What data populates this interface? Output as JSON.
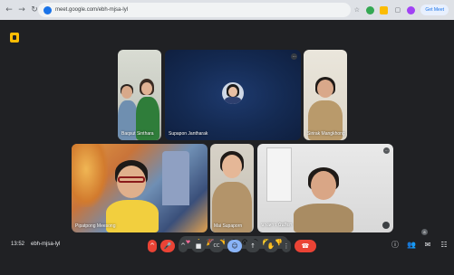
{
  "browser": {
    "url": "meet.google.com/ebh-mjsa-lyl",
    "profile_label": "Get Meet"
  },
  "meeting": {
    "time": "13:52",
    "code": "ebh-mjsa-lyl",
    "participant_count": "8"
  },
  "tiles": [
    {
      "name": "Baqsut Sinthara",
      "badge": ""
    },
    {
      "name": "Supapon Jantharak",
      "badge": "⋯"
    },
    {
      "name": "Sirirak Mangkhong",
      "badge": ""
    },
    {
      "name": "Pipatpong Meesong",
      "badge": ""
    },
    {
      "name": "Mai Supaporn",
      "badge": ""
    },
    {
      "name": "นางสาว นันทิยา",
      "badge": "⋯"
    }
  ],
  "reactions": [
    "❤",
    "👍",
    "🎉",
    "👏",
    "😂",
    "😮",
    "😢",
    "🤔",
    "👎"
  ],
  "controls": {
    "caret": "^",
    "mic": "🎤",
    "cam": "■",
    "captions": "CC",
    "emoji": "☺",
    "present": "↑",
    "raise_hand": "✋",
    "more": "⋮",
    "end_call": "☎"
  },
  "right_controls": {
    "info": "ⓘ",
    "people": "👥",
    "chat": "✉",
    "activities": "☷"
  },
  "colors": {
    "end_call": "#ea4335",
    "mic_off": "#ea4335",
    "active_control": "#8ab4f8",
    "background": "#202124"
  }
}
